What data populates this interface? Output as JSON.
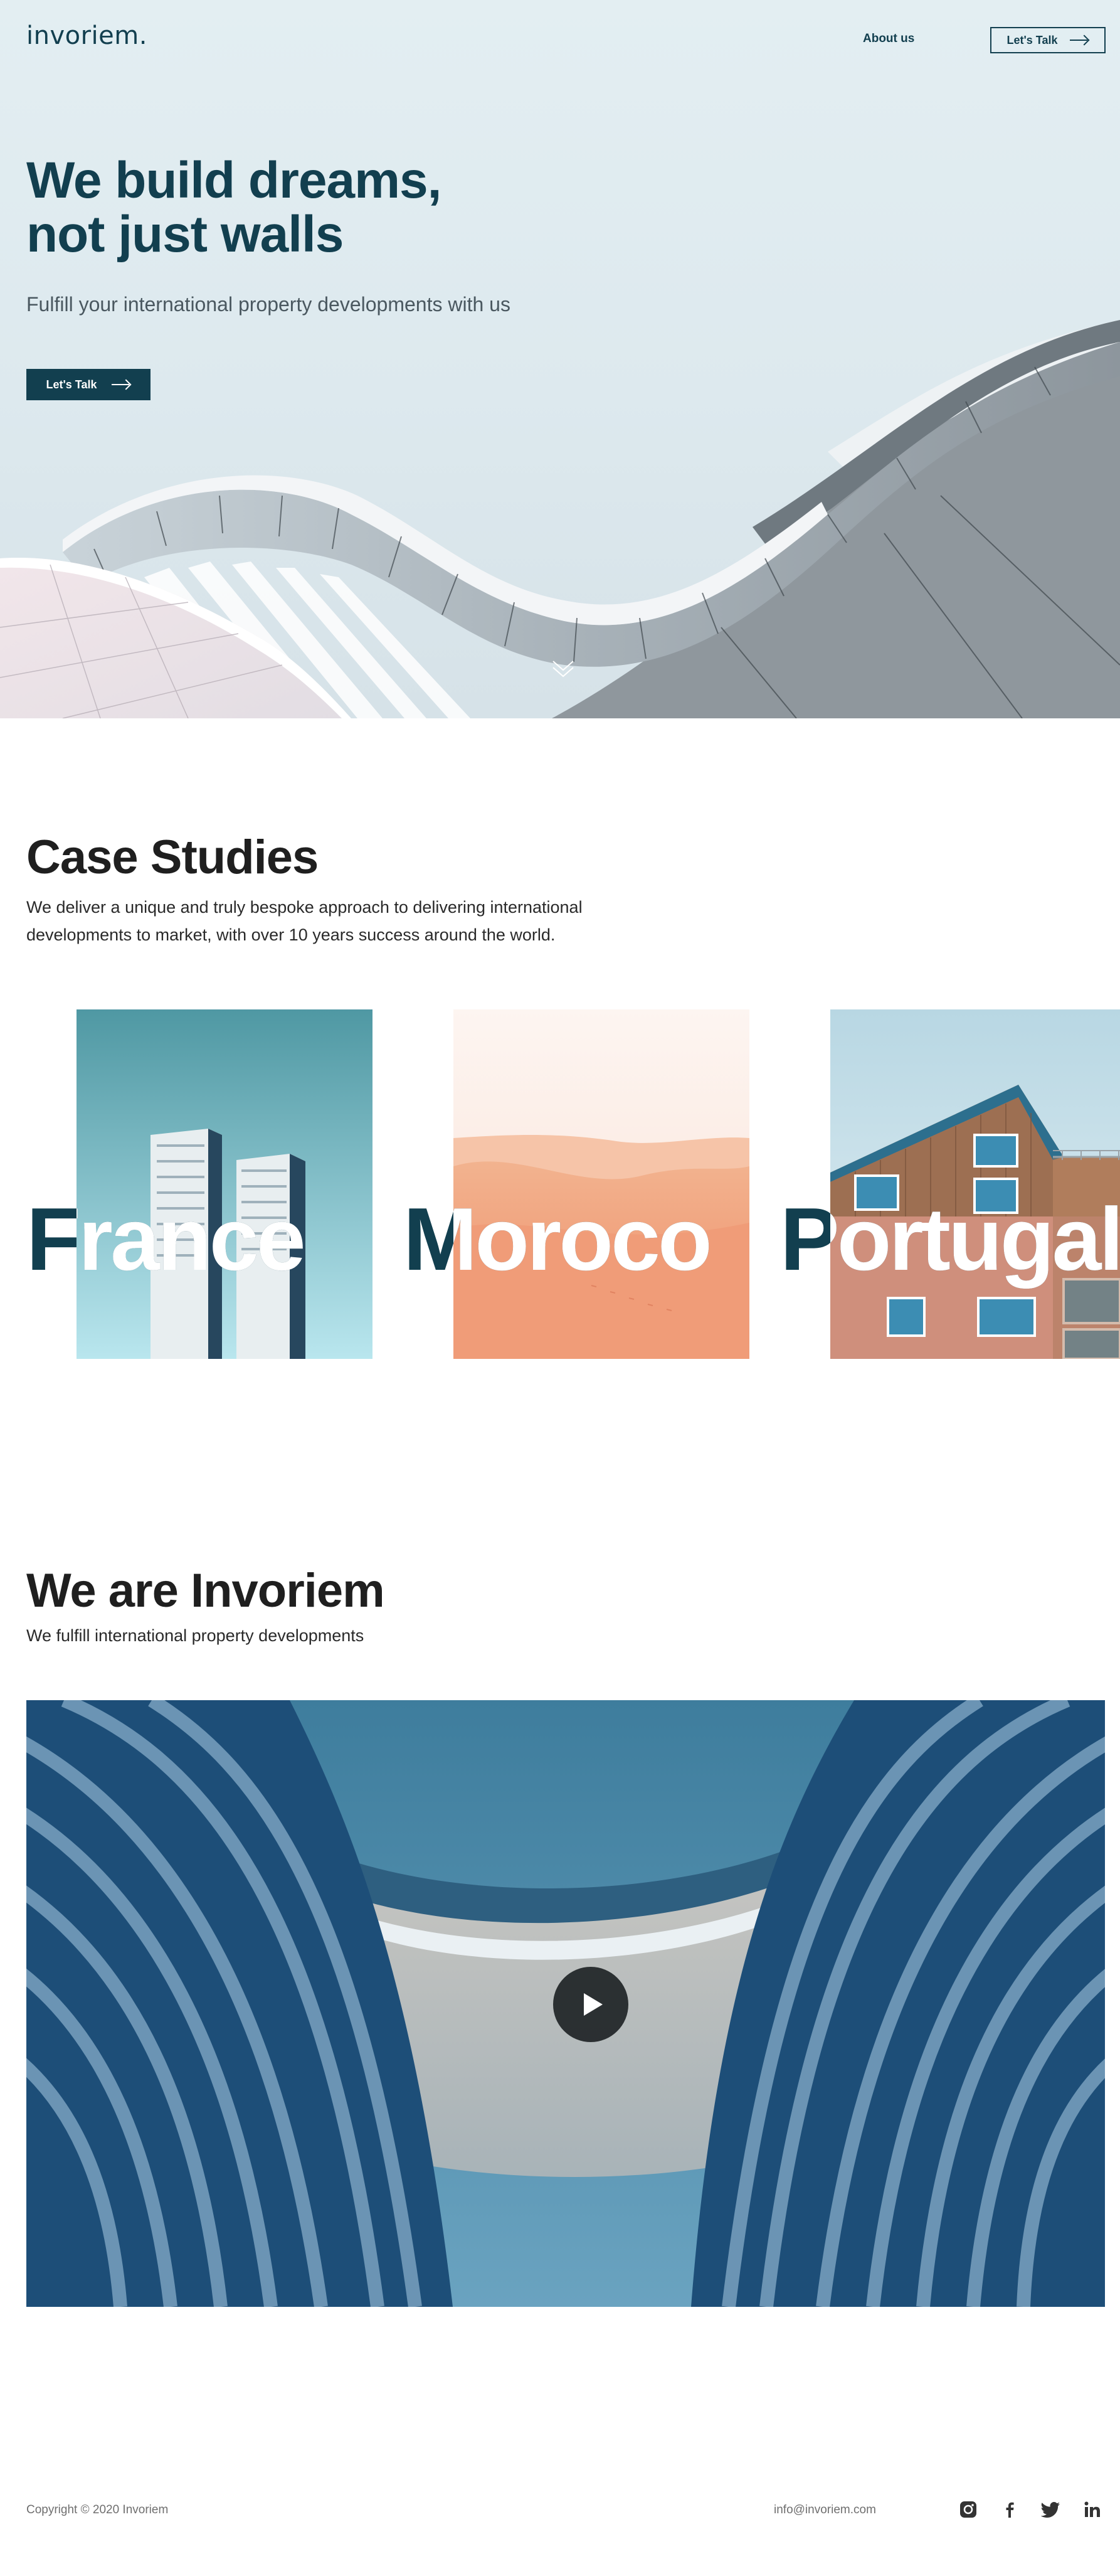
{
  "header": {
    "logo": "invoriem.",
    "nav_about": "About us",
    "nav_cta": "Let's Talk"
  },
  "hero": {
    "title_line1": "We build dreams,",
    "title_line2": "not just walls",
    "subtitle": "Fulfill your international property developments with us",
    "cta": "Let's Talk"
  },
  "case_studies": {
    "title": "Case Studies",
    "description": "We deliver a unique and truly bespoke approach to delivering international developments to market, with over 10 years success around the world.",
    "items": [
      {
        "label": "France"
      },
      {
        "label": "Moroco"
      },
      {
        "label": "Portugal"
      }
    ]
  },
  "about": {
    "title": "We are Invoriem",
    "subtitle": "We fulfill international property developments"
  },
  "footer": {
    "copyright": "Copyright © 2020 Invoriem",
    "email": "info@invoriem.com"
  },
  "colors": {
    "brand_dark": "#123f4f",
    "text": "#1f1f1f",
    "muted": "#6f6f6f"
  },
  "icons": {
    "social": [
      "instagram-icon",
      "facebook-icon",
      "twitter-icon",
      "linkedin-icon"
    ],
    "scroll": "chevron-down-icon",
    "play": "play-icon"
  }
}
